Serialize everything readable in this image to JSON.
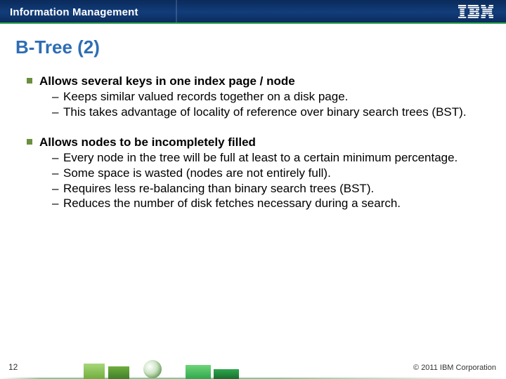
{
  "header": {
    "brand": "Information Management"
  },
  "logo": {
    "text": "IBM"
  },
  "title": "B-Tree (2)",
  "bullets": [
    {
      "head": "Allows several keys in one index page / node",
      "subs": [
        "Keeps similar valued records together on a disk page.",
        "This takes advantage of locality of reference over binary search trees (BST)."
      ]
    },
    {
      "head": "Allows nodes to be incompletely filled",
      "subs": [
        "Every node in the tree will be full at least to a certain minimum percentage.",
        "Some space is wasted (nodes are not entirely full).",
        "Requires less re-balancing than binary search trees (BST).",
        "Reduces the number of disk fetches necessary during a search."
      ]
    }
  ],
  "footer": {
    "page": "12",
    "copyright": "© 2011 IBM Corporation"
  }
}
